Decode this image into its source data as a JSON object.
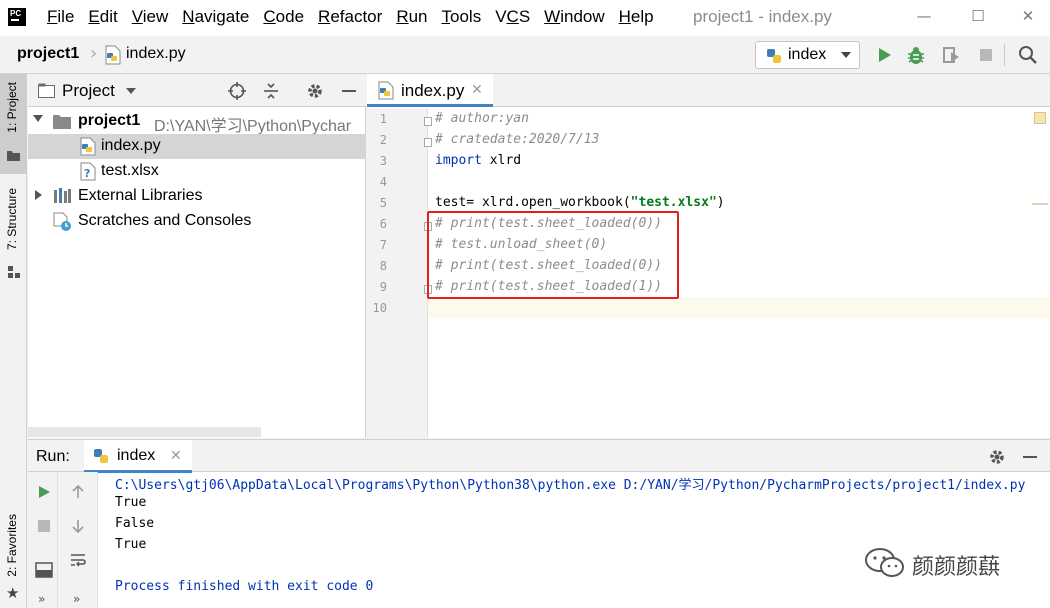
{
  "window": {
    "title": "project1 - index.py",
    "minimize": "—",
    "maximize": "☐",
    "close": "✕"
  },
  "menu": [
    {
      "label": "File",
      "mnemonic_index": 0
    },
    {
      "label": "Edit",
      "mnemonic_index": 0
    },
    {
      "label": "View",
      "mnemonic_index": 0
    },
    {
      "label": "Navigate",
      "mnemonic_index": 0
    },
    {
      "label": "Code",
      "mnemonic_index": 0
    },
    {
      "label": "Refactor",
      "mnemonic_index": 0
    },
    {
      "label": "Run",
      "mnemonic_index": 0
    },
    {
      "label": "Tools",
      "mnemonic_index": 0
    },
    {
      "label": "VCS",
      "mnemonic_index": 1
    },
    {
      "label": "Window",
      "mnemonic_index": 0
    },
    {
      "label": "Help",
      "mnemonic_index": 0
    }
  ],
  "navbar": {
    "project": "project1",
    "file": "index.py",
    "run_config": "index"
  },
  "left_strip": {
    "project_tab": "1: Project",
    "structure_tab": "7: Structure",
    "favorites_tab": "2: Favorites"
  },
  "project_panel": {
    "title": "Project",
    "tree": {
      "root_name": "project1",
      "root_path": "D:\\YAN\\学习\\Python\\Pychar",
      "file1": "index.py",
      "file2": "test.xlsx",
      "ext_libs": "External Libraries",
      "scratches": "Scratches and Consoles"
    }
  },
  "editor": {
    "tab_label": "index.py",
    "line_numbers": [
      "1",
      "2",
      "3",
      "4",
      "5",
      "6",
      "7",
      "8",
      "9",
      "10"
    ],
    "l1": "# author:yan",
    "l2": "# cratedate:2020/7/13",
    "l3_kw": "import",
    "l3_rest": " xlrd",
    "l5_pre": "test= xlrd.open_workbook(",
    "l5_str": "\"test.xlsx\"",
    "l5_post": ")",
    "l6": "# print(test.sheet_loaded(0))",
    "l7": "# test.unload_sheet(0)",
    "l8": "# print(test.sheet_loaded(0))",
    "l9": "# print(test.sheet_loaded(1))"
  },
  "run_panel": {
    "label": "Run:",
    "tab_label": "index",
    "output": {
      "cmd": "C:\\Users\\gtj06\\AppData\\Local\\Programs\\Python\\Python38\\python.exe D:/YAN/学习/Python/PycharmProjects/project1/index.py",
      "o1": "True",
      "o2": "False",
      "o3": "True",
      "exit": "Process finished with exit code 0"
    }
  },
  "watermark": "颜颜颜蕻",
  "colors": {
    "accent": "#4083c9",
    "run_green": "#499c54",
    "highlight_red": "#e0201b",
    "keyword": "#0033b3",
    "string": "#067d17",
    "comment": "#8c8c8c"
  }
}
